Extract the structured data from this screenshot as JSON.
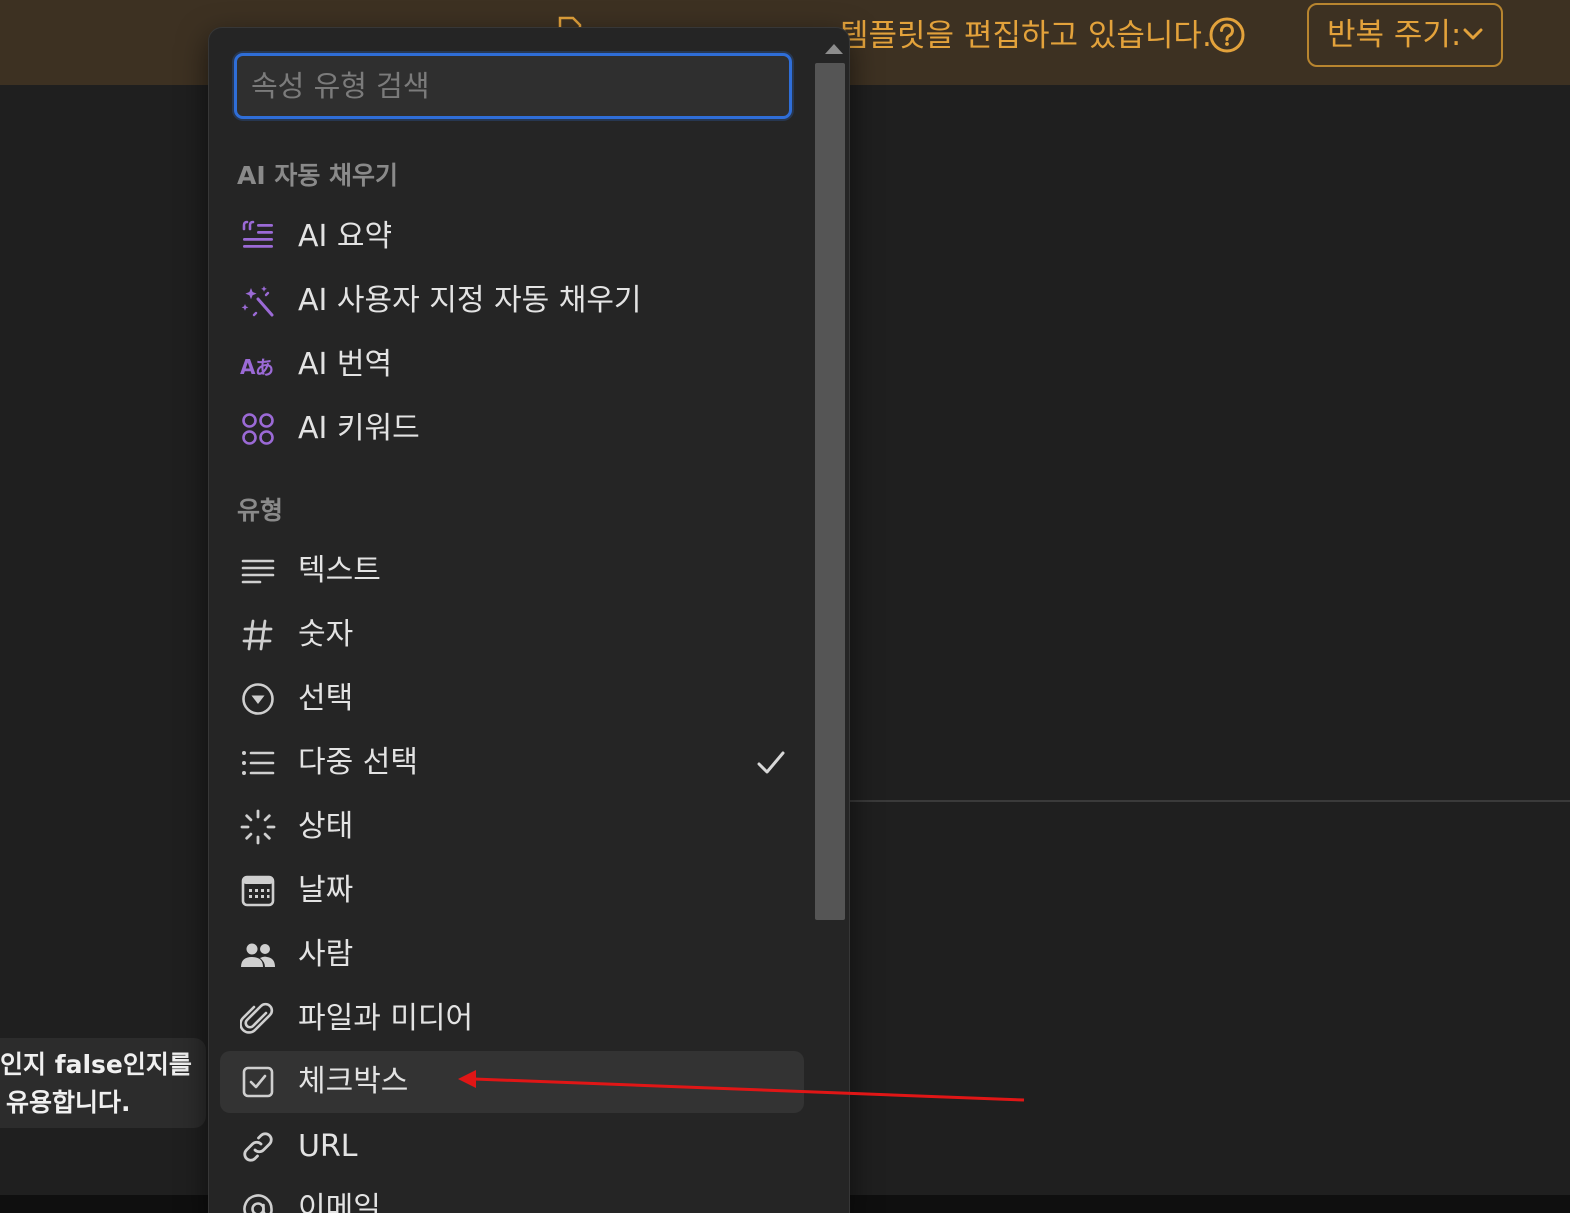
{
  "banner": {
    "text": "템플릿을 편집하고 있습니다.",
    "repeat_label": "반복 주기:"
  },
  "tooltip": {
    "line1": "인지 false인지를",
    "line2": "유용합니다."
  },
  "dropdown": {
    "search_placeholder": "속성 유형 검색",
    "ai_section": "AI 자동 채우기",
    "ai_items": [
      {
        "label": "AI 요약",
        "icon": "ai-summary-icon"
      },
      {
        "label": "AI 사용자 지정 자동 채우기",
        "icon": "ai-sparkle-wand-icon"
      },
      {
        "label": "AI 번역",
        "icon": "ai-translate-icon"
      },
      {
        "label": "AI 키워드",
        "icon": "ai-keywords-icon"
      }
    ],
    "type_section": "유형",
    "type_items": [
      {
        "label": "텍스트",
        "icon": "text-lines-icon"
      },
      {
        "label": "숫자",
        "icon": "hash-icon"
      },
      {
        "label": "선택",
        "icon": "select-circle-icon"
      },
      {
        "label": "다중 선택",
        "icon": "multi-select-list-icon",
        "selected": true
      },
      {
        "label": "상태",
        "icon": "status-loader-icon"
      },
      {
        "label": "날짜",
        "icon": "calendar-icon"
      },
      {
        "label": "사람",
        "icon": "people-icon"
      },
      {
        "label": "파일과 미디어",
        "icon": "paperclip-icon"
      },
      {
        "label": "체크박스",
        "icon": "checkbox-icon",
        "hovered": true
      },
      {
        "label": "URL",
        "icon": "link-icon"
      },
      {
        "label": "이메일",
        "icon": "at-sign-icon"
      }
    ]
  },
  "colors": {
    "banner_bg": "#3d3122",
    "banner_text": "#e3a23b",
    "ai_purple": "#9b6ad6",
    "focus_blue": "#2f6ed8",
    "annotation_red": "#e01616"
  }
}
